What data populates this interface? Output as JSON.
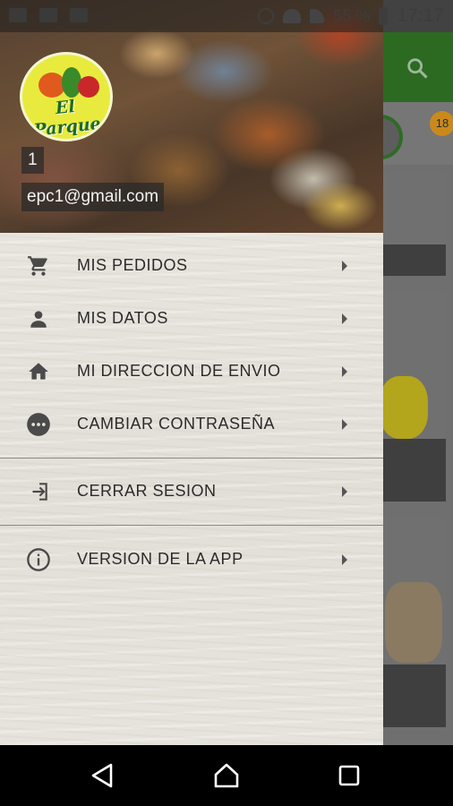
{
  "status_bar": {
    "battery_percent": "55 %",
    "time": "17:17"
  },
  "background": {
    "badge_count": "18"
  },
  "drawer": {
    "user_number": "1",
    "user_email": "epc1@gmail.com",
    "logo_text": "El Parque",
    "menu": [
      {
        "label": "MIS PEDIDOS",
        "icon": "cart-icon"
      },
      {
        "label": "MIS DATOS",
        "icon": "person-icon"
      },
      {
        "label": "MI DIRECCION DE ENVIO",
        "icon": "home-icon"
      },
      {
        "label": "CAMBIAR CONTRASEÑA",
        "icon": "more-dots-icon"
      },
      {
        "label": "CERRAR SESION",
        "icon": "logout-icon"
      },
      {
        "label": "VERSION DE LA APP",
        "icon": "info-icon"
      }
    ]
  },
  "colors": {
    "app_bar_green": "#2c6a22",
    "logo_yellow": "#e8eb3e",
    "text_dark": "#2b2b2b"
  }
}
